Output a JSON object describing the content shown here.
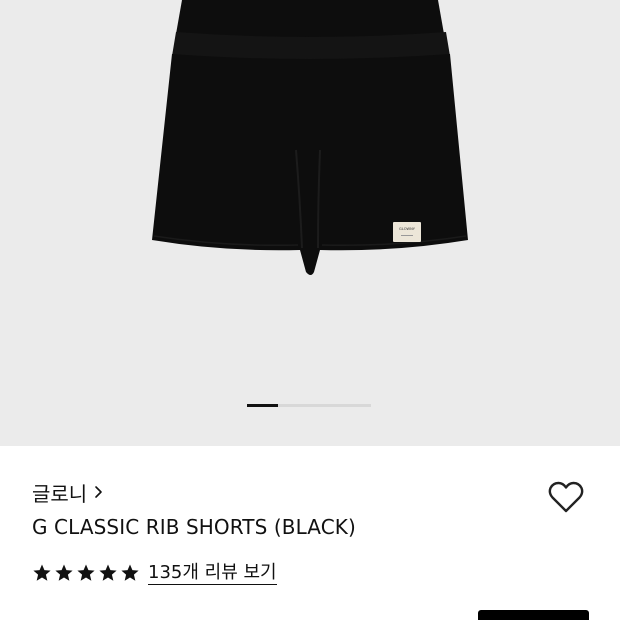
{
  "product": {
    "brand": "글로니",
    "name": "G CLASSIC RIB SHORTS (BLACK)",
    "garment_label": "GLOWNY",
    "rating_stars": 5,
    "review_link": "135개 리뷰 보기"
  },
  "carousel": {
    "current_index": 1,
    "progress_fraction": 0.25
  },
  "icons": {
    "brand_chevron": "chevron-right-icon",
    "wishlist": "heart-outline-icon",
    "star": "star-filled-icon"
  },
  "colors": {
    "image_background": "#ebebeb",
    "garment": "#0d0d0d",
    "text": "#111111",
    "indicator_active": "#111111",
    "indicator_track": "#d8d8d8"
  }
}
